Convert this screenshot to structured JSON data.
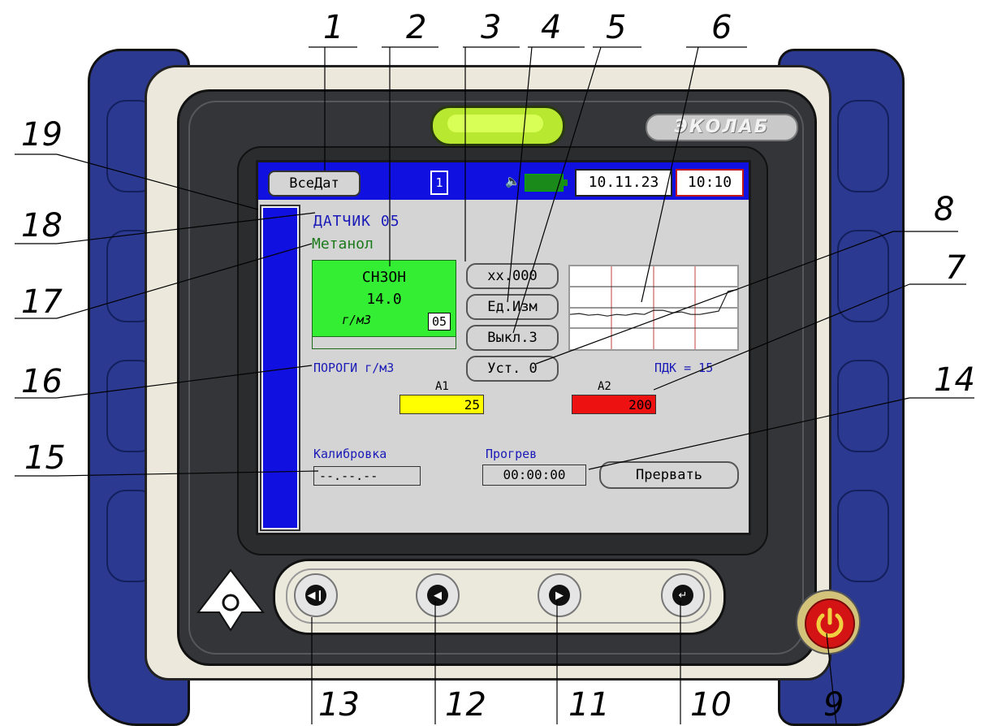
{
  "device": {
    "brand_logo": "ЭКОЛАБ"
  },
  "screen": {
    "top_bar": {
      "all_sensors_button": "ВсеДат",
      "sd_card_indicator": "1",
      "date": "10.11.23",
      "time": "10:10"
    },
    "sensor_title": "ДАТЧИК 05",
    "gas_name": "Метанол",
    "measurement": {
      "formula": "CH3OH",
      "value": "14.0",
      "unit": "г/м3",
      "channel": "05"
    },
    "buttons": {
      "precision": "xx.000",
      "units": "Ед.Изм",
      "sound_off": "Выкл.З",
      "set_zero": "Уст. 0"
    },
    "thresholds_label": "ПОРОГИ г/м3",
    "pdk_label": "ПДК = 15",
    "threshold_a1": {
      "label": "A1",
      "value": "25"
    },
    "threshold_a2": {
      "label": "A2",
      "value": "200"
    },
    "calibration_label": "Калибровка",
    "calibration_value": "--.--.--",
    "warmup_label": "Прогрев",
    "warmup_value": "00:00:00",
    "abort_button": "Прервать",
    "trend_graph_values": [
      0.42,
      0.43,
      0.41,
      0.42,
      0.4,
      0.42,
      0.41,
      0.43,
      0.42,
      0.47,
      0.47,
      0.44,
      0.45,
      0.42,
      0.42,
      0.44,
      0.46,
      0.7,
      0.72
    ]
  },
  "callouts": [
    "1",
    "2",
    "3",
    "4",
    "5",
    "6",
    "7",
    "8",
    "9",
    "10",
    "11",
    "12",
    "13",
    "14",
    "15",
    "16",
    "17",
    "18",
    "19"
  ],
  "colors": {
    "grip": "#2b3990",
    "lcd_header": "#1010e0",
    "measurement_bg": "#33ee33",
    "a1_bg": "#ffff00",
    "a2_bg": "#ee1111",
    "led": "#b8e830",
    "power": "#d41414"
  }
}
